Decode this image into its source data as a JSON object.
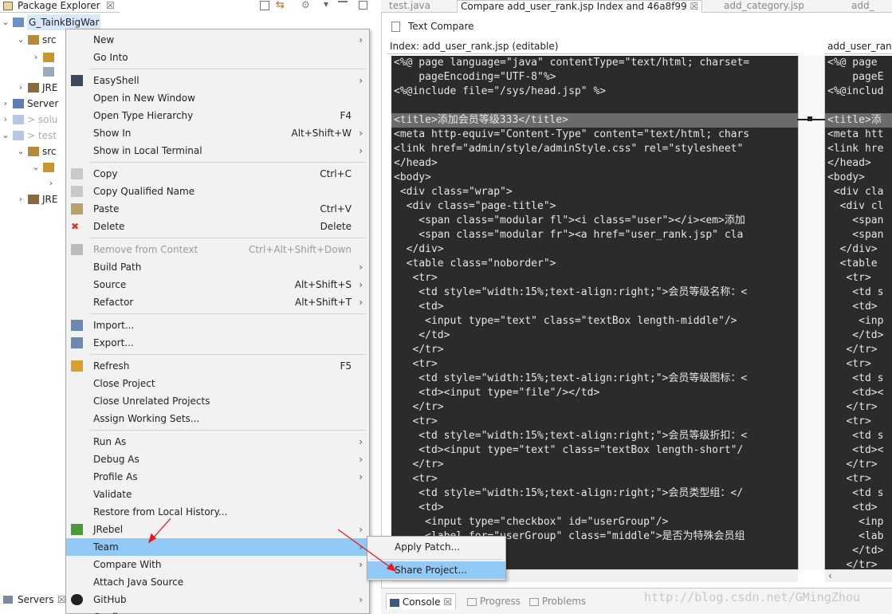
{
  "package_explorer": {
    "title": "Package Explorer",
    "tree": [
      {
        "label": "G_TainkBigWar",
        "level": 0,
        "expanded": true,
        "selected": true,
        "icon": "project-icon"
      },
      {
        "label": "src",
        "level": 1,
        "expanded": true,
        "icon": "package-folder-icon"
      },
      {
        "label": "",
        "level": 2,
        "expanded": false,
        "icon": "package-icon"
      },
      {
        "label": "",
        "level": 2,
        "expanded": null,
        "icon": "file-icon"
      },
      {
        "label": "JRE",
        "level": 1,
        "expanded": false,
        "icon": "library-icon"
      },
      {
        "label": "Server",
        "level": 0,
        "expanded": false,
        "icon": "folder-icon"
      },
      {
        "label": "> solu",
        "level": 0,
        "expanded": false,
        "icon": "project-icon",
        "faded": true
      },
      {
        "label": "> test",
        "level": 0,
        "expanded": true,
        "icon": "project-icon",
        "faded": true
      },
      {
        "label": "src",
        "level": 1,
        "expanded": true,
        "icon": "package-folder-icon"
      },
      {
        "label": "",
        "level": 2,
        "expanded": true,
        "icon": "package-icon"
      },
      {
        "label": "",
        "level": 3,
        "expanded": false,
        "icon": ""
      },
      {
        "label": "JRE",
        "level": 1,
        "expanded": false,
        "icon": "library-icon"
      }
    ],
    "servers_tab": "Servers"
  },
  "editor": {
    "tabs": [
      {
        "label": "test.java",
        "active": false
      },
      {
        "label": "Compare add_user_rank.jsp Index and 46a8f99",
        "active": true
      },
      {
        "label": "add_category.jsp",
        "active": false
      },
      {
        "label": "add_",
        "active": false
      }
    ],
    "text_compare_title": "Text Compare",
    "left_header": "Index: add_user_rank.jsp (editable)",
    "right_header": "add_user_rank.jsp",
    "left_lines": [
      "<%@ page language=\"java\" contentType=\"text/html; charset=",
      "    pageEncoding=\"UTF-8\"%>",
      "<%@include file=\"/sys/head.jsp\" %>",
      "",
      "<title>添加会员等级333</title>",
      "<meta http-equiv=\"Content-Type\" content=\"text/html; chars",
      "<link href=\"admin/style/adminStyle.css\" rel=\"stylesheet\"",
      "</head>",
      "<body>",
      " <div class=\"wrap\">",
      "  <div class=\"page-title\">",
      "    <span class=\"modular fl\"><i class=\"user\"></i><em>添加",
      "    <span class=\"modular fr\"><a href=\"user_rank.jsp\" cla",
      "  </div>",
      "  <table class=\"noborder\">",
      "   <tr>",
      "    <td style=\"width:15%;text-align:right;\">会员等级名称：<",
      "    <td>",
      "     <input type=\"text\" class=\"textBox length-middle\"/>",
      "    </td>",
      "   </tr>",
      "   <tr>",
      "    <td style=\"width:15%;text-align:right;\">会员等级图标：<",
      "    <td><input type=\"file\"/></td>",
      "   </tr>",
      "   <tr>",
      "    <td style=\"width:15%;text-align:right;\">会员等级折扣：<",
      "    <td><input type=\"text\" class=\"textBox length-short\"/",
      "   </tr>",
      "   <tr>",
      "    <td style=\"width:15%;text-align:right;\">会员类型组：</",
      "    <td>",
      "     <input type=\"checkbox\" id=\"userGroup\"/>",
      "     <label for=\"userGroup\" class=\"middle\">是否为特殊会员组"
    ],
    "right_lines": [
      "<%@ page",
      "    pageE",
      "<%@includ",
      "",
      "<title>添",
      "<meta htt",
      "<link hre",
      "</head>",
      "<body>",
      " <div cla",
      "  <div cl",
      "    <span",
      "    <span",
      "  </div>",
      "  <table",
      "   <tr>",
      "    <td s",
      "    <td>",
      "     <inp",
      "    </td>",
      "   </tr>",
      "   <tr>",
      "    <td s",
      "    <td><",
      "   </tr>",
      "   <tr>",
      "    <td s",
      "    <td><",
      "   </tr>",
      "   <tr>",
      "    <td s",
      "    <td>",
      "     <inp",
      "     <lab",
      "    </td>",
      "   </tr>"
    ],
    "highlight_line_index": 4,
    "bottom_tabs": [
      {
        "label": "Console",
        "active": true
      },
      {
        "label": "Progress",
        "active": false
      },
      {
        "label": "Problems",
        "active": false
      }
    ],
    "watermark": "http://blog.csdn.net/GMingZhou"
  },
  "context_menu": {
    "items": [
      {
        "label": "New",
        "shortcut": "",
        "submenu": true,
        "icon": ""
      },
      {
        "label": "Go Into",
        "shortcut": "",
        "submenu": false,
        "icon": ""
      },
      {
        "sep": true
      },
      {
        "label": "EasyShell",
        "shortcut": "",
        "submenu": true,
        "icon": "terminal-icon"
      },
      {
        "label": "Open in New Window",
        "shortcut": "",
        "submenu": false,
        "icon": ""
      },
      {
        "label": "Open Type Hierarchy",
        "shortcut": "F4",
        "submenu": false,
        "icon": ""
      },
      {
        "label": "Show In",
        "shortcut": "Alt+Shift+W",
        "submenu": true,
        "icon": ""
      },
      {
        "label": "Show in Local Terminal",
        "shortcut": "",
        "submenu": true,
        "icon": ""
      },
      {
        "sep": true
      },
      {
        "label": "Copy",
        "shortcut": "Ctrl+C",
        "submenu": false,
        "icon": "copy-icon"
      },
      {
        "label": "Copy Qualified Name",
        "shortcut": "",
        "submenu": false,
        "icon": "copy-icon"
      },
      {
        "label": "Paste",
        "shortcut": "Ctrl+V",
        "submenu": false,
        "icon": "paste-icon"
      },
      {
        "label": "Delete",
        "shortcut": "Delete",
        "submenu": false,
        "icon": "delete-icon"
      },
      {
        "sep": true
      },
      {
        "label": "Remove from Context",
        "shortcut": "Ctrl+Alt+Shift+Down",
        "submenu": false,
        "icon": "remove-context-icon",
        "disabled": true
      },
      {
        "label": "Build Path",
        "shortcut": "",
        "submenu": true,
        "icon": ""
      },
      {
        "label": "Source",
        "shortcut": "Alt+Shift+S",
        "submenu": true,
        "icon": ""
      },
      {
        "label": "Refactor",
        "shortcut": "Alt+Shift+T",
        "submenu": true,
        "icon": ""
      },
      {
        "sep": true
      },
      {
        "label": "Import...",
        "shortcut": "",
        "submenu": false,
        "icon": "import-icon"
      },
      {
        "label": "Export...",
        "shortcut": "",
        "submenu": false,
        "icon": "export-icon"
      },
      {
        "sep": true
      },
      {
        "label": "Refresh",
        "shortcut": "F5",
        "submenu": false,
        "icon": "refresh-icon"
      },
      {
        "label": "Close Project",
        "shortcut": "",
        "submenu": false,
        "icon": ""
      },
      {
        "label": "Close Unrelated Projects",
        "shortcut": "",
        "submenu": false,
        "icon": ""
      },
      {
        "label": "Assign Working Sets...",
        "shortcut": "",
        "submenu": false,
        "icon": ""
      },
      {
        "sep": true
      },
      {
        "label": "Run As",
        "shortcut": "",
        "submenu": true,
        "icon": ""
      },
      {
        "label": "Debug As",
        "shortcut": "",
        "submenu": true,
        "icon": ""
      },
      {
        "label": "Profile As",
        "shortcut": "",
        "submenu": true,
        "icon": ""
      },
      {
        "label": "Validate",
        "shortcut": "",
        "submenu": false,
        "icon": ""
      },
      {
        "label": "Restore from Local History...",
        "shortcut": "",
        "submenu": false,
        "icon": ""
      },
      {
        "label": "JRebel",
        "shortcut": "",
        "submenu": true,
        "icon": "jrebel-icon"
      },
      {
        "label": "Team",
        "shortcut": "",
        "submenu": true,
        "icon": "",
        "selected": true
      },
      {
        "label": "Compare With",
        "shortcut": "",
        "submenu": true,
        "icon": ""
      },
      {
        "label": "Attach Java Source",
        "shortcut": "",
        "submenu": false,
        "icon": ""
      },
      {
        "label": "GitHub",
        "shortcut": "",
        "submenu": true,
        "icon": "github-icon"
      },
      {
        "label": "Config",
        "shortcut": "",
        "submenu": true,
        "icon": ""
      }
    ]
  },
  "team_submenu": {
    "items": [
      {
        "label": "Apply Patch...",
        "selected": false
      },
      {
        "label": "Share Project...",
        "selected": true
      }
    ]
  },
  "colors": {
    "selection": "#91c9f7",
    "editor_bg": "#2b2b2b",
    "arrow": "#e8191c"
  }
}
